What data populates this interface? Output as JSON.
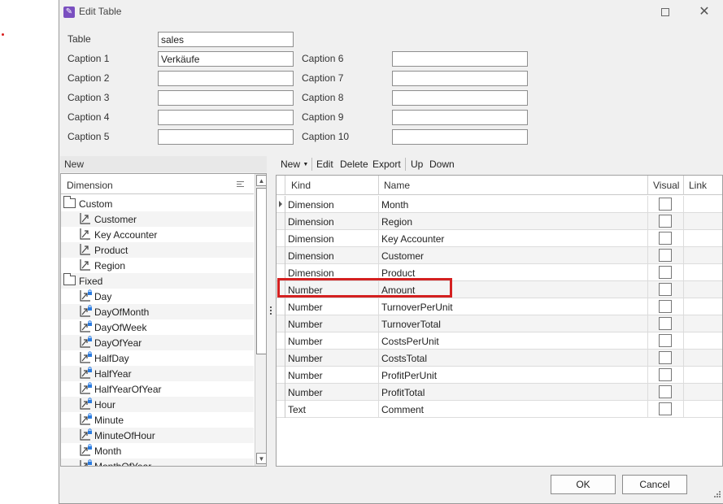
{
  "window": {
    "title": "Edit Table"
  },
  "form": {
    "table_label": "Table",
    "table_value": "sales",
    "captions_left": [
      {
        "label": "Caption 1",
        "value": "Verkäufe"
      },
      {
        "label": "Caption 2",
        "value": ""
      },
      {
        "label": "Caption 3",
        "value": ""
      },
      {
        "label": "Caption 4",
        "value": ""
      },
      {
        "label": "Caption 5",
        "value": ""
      }
    ],
    "captions_right": [
      {
        "label": "Caption 6",
        "value": ""
      },
      {
        "label": "Caption 7",
        "value": ""
      },
      {
        "label": "Caption 8",
        "value": ""
      },
      {
        "label": "Caption 9",
        "value": ""
      },
      {
        "label": "Caption 10",
        "value": ""
      }
    ]
  },
  "left_panel": {
    "new_label": "New",
    "tree_header": "Dimension",
    "groups": [
      {
        "label": "Custom",
        "items": [
          "Customer",
          "Key Accounter",
          "Product",
          "Region"
        ]
      },
      {
        "label": "Fixed",
        "items": [
          "Day",
          "DayOfMonth",
          "DayOfWeek",
          "DayOfYear",
          "HalfDay",
          "HalfYear",
          "HalfYearOfYear",
          "Hour",
          "Minute",
          "MinuteOfHour",
          "Month",
          "MonthOfYear"
        ]
      }
    ]
  },
  "toolbar": {
    "new": "New",
    "edit": "Edit",
    "delete": "Delete",
    "export": "Export",
    "up": "Up",
    "down": "Down"
  },
  "grid": {
    "columns": [
      "Kind",
      "Name",
      "Visual",
      "Link"
    ],
    "rows": [
      {
        "kind": "Dimension",
        "name": "Month"
      },
      {
        "kind": "Dimension",
        "name": "Region"
      },
      {
        "kind": "Dimension",
        "name": "Key Accounter"
      },
      {
        "kind": "Dimension",
        "name": "Customer"
      },
      {
        "kind": "Dimension",
        "name": "Product"
      },
      {
        "kind": "Number",
        "name": "Amount"
      },
      {
        "kind": "Number",
        "name": "TurnoverPerUnit"
      },
      {
        "kind": "Number",
        "name": "TurnoverTotal"
      },
      {
        "kind": "Number",
        "name": "CostsPerUnit"
      },
      {
        "kind": "Number",
        "name": "CostsTotal"
      },
      {
        "kind": "Number",
        "name": "ProfitPerUnit"
      },
      {
        "kind": "Number",
        "name": "ProfitTotal"
      },
      {
        "kind": "Text",
        "name": "Comment"
      }
    ]
  },
  "footer": {
    "ok": "OK",
    "cancel": "Cancel"
  },
  "colors": {
    "accent_icon": "#7a4fc0",
    "highlight": "#d42020",
    "window_bg": "#f0f0f0"
  }
}
